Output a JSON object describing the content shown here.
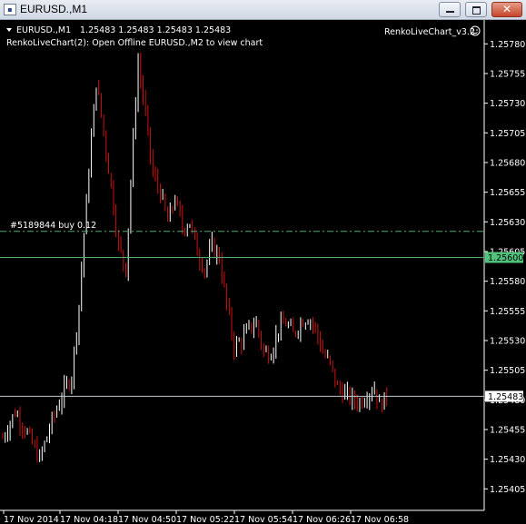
{
  "window": {
    "title": "EURUSD.,M1",
    "icon": "chart-window-icon",
    "buttons": [
      "minimize",
      "maximize",
      "close"
    ],
    "close_symbol": "✕"
  },
  "chart": {
    "header_symbol": "EURUSD.,M1",
    "header_ohlc": "1.25483 1.25483 1.25483 1.25483",
    "indicator_msg": "RenkoLiveChart(2): Open Offline EURUSD.,M2 to view chart",
    "ea_name": "RenkoLiveChart_v3.2",
    "ea_status_icon": "smiley-icon",
    "order_label": "#5189844 buy 0.12",
    "bid_price": "1.25483",
    "order_price_label": "1.25600",
    "colors": {
      "bg": "#000000",
      "bull": "#ffffff",
      "bear": "#d01010",
      "order_line": "#4fae6e",
      "bid_line": "#bfc8cf",
      "order_tag": "#50c27c",
      "axis": "#ffffff"
    }
  },
  "chart_data": {
    "type": "candlestick",
    "y_ticks": [
      "1.25780",
      "1.25755",
      "1.25730",
      "1.25705",
      "1.25680",
      "1.25655",
      "1.25630",
      "1.25605",
      "1.25580",
      "1.25555",
      "1.25530",
      "1.25505",
      "1.25480",
      "1.25455",
      "1.25430",
      "1.25405"
    ],
    "x_ticks": [
      "17 Nov 2014",
      "17 Nov 04:18",
      "17 Nov 04:50",
      "17 Nov 05:22",
      "17 Nov 05:54",
      "17 Nov 06:26",
      "17 Nov 06:58"
    ],
    "ylim": [
      1.25393,
      1.25794
    ],
    "bid_level": 1.25483,
    "order_level": 1.25622,
    "trend": [
      [
        0,
        1.25448
      ],
      [
        5,
        1.2547
      ],
      [
        10,
        1.25452
      ],
      [
        15,
        1.2543
      ],
      [
        20,
        1.25462
      ],
      [
        25,
        1.25488
      ],
      [
        28,
        1.255
      ],
      [
        31,
        1.2556
      ],
      [
        33,
        1.2562
      ],
      [
        36,
        1.257
      ],
      [
        38,
        1.25748
      ],
      [
        40,
        1.2572
      ],
      [
        44,
        1.2566
      ],
      [
        47,
        1.2561
      ],
      [
        50,
        1.2559
      ],
      [
        53,
        1.257
      ],
      [
        55,
        1.25765
      ],
      [
        58,
        1.2572
      ],
      [
        61,
        1.2567
      ],
      [
        64,
        1.25655
      ],
      [
        67,
        1.2563
      ],
      [
        70,
        1.2565
      ],
      [
        73,
        1.25625
      ],
      [
        76,
        1.2563
      ],
      [
        79,
        1.25605
      ],
      [
        82,
        1.2559
      ],
      [
        85,
        1.2561
      ],
      [
        88,
        1.256
      ],
      [
        91,
        1.2556
      ],
      [
        94,
        1.25525
      ],
      [
        97,
        1.2553
      ],
      [
        100,
        1.2554
      ],
      [
        103,
        1.25545
      ],
      [
        106,
        1.2552
      ],
      [
        109,
        1.2552
      ],
      [
        112,
        1.2554
      ],
      [
        115,
        1.25545
      ],
      [
        118,
        1.25535
      ],
      [
        121,
        1.25545
      ],
      [
        124,
        1.2555
      ],
      [
        127,
        1.2554
      ],
      [
        130,
        1.2552
      ],
      [
        133,
        1.2551
      ],
      [
        136,
        1.2549
      ],
      [
        139,
        1.25485
      ],
      [
        142,
        1.2548
      ],
      [
        145,
        1.25478
      ],
      [
        148,
        1.25485
      ],
      [
        151,
        1.2549
      ],
      [
        153,
        1.25475
      ],
      [
        156,
        1.25483
      ]
    ]
  }
}
